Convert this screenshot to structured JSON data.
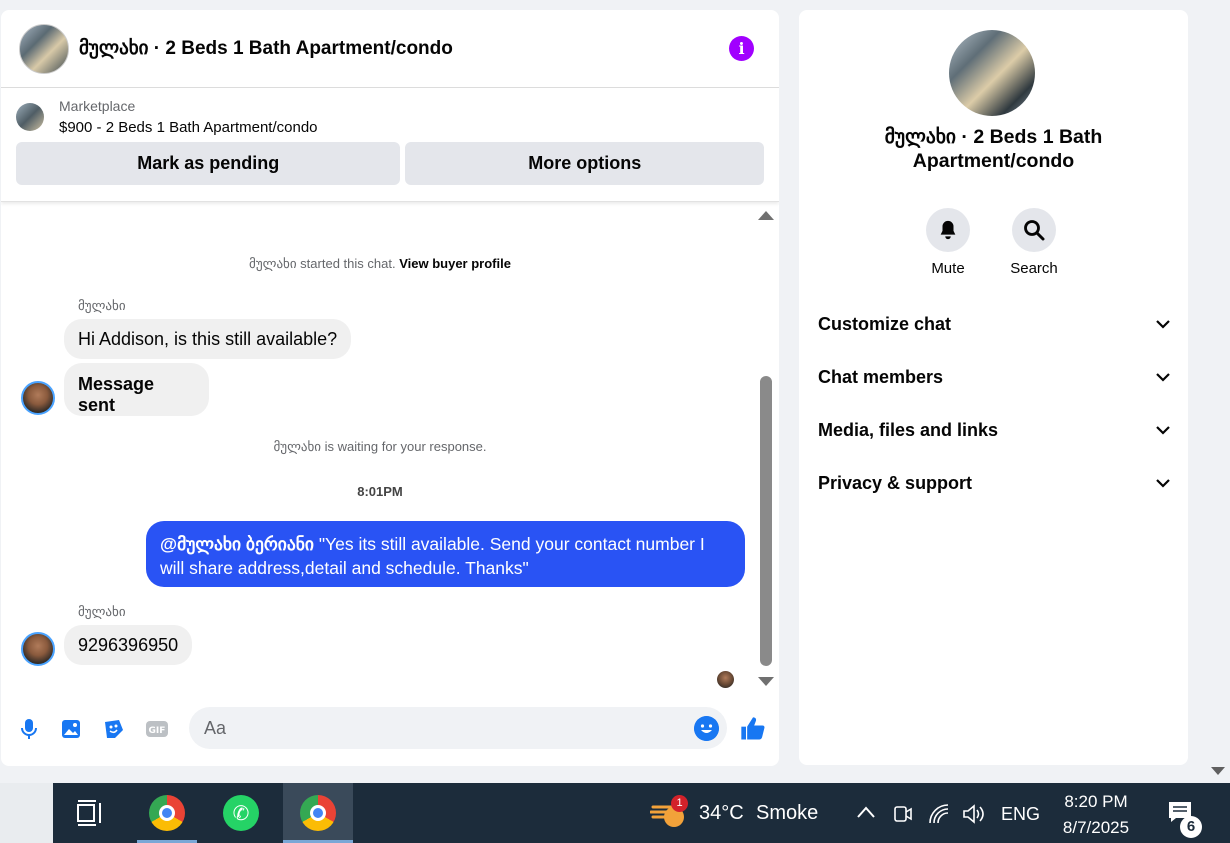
{
  "chat": {
    "title": "მულახი · 2 Beds 1 Bath Apartment/condo",
    "marketplace_label": "Marketplace",
    "listing": "$900 - 2 Beds 1 Bath Apartment/condo",
    "mark_pending_label": "Mark as pending",
    "more_options_label": "More options",
    "started_text": "მულახი started this chat.",
    "view_buyer_profile": "View buyer profile",
    "sender_name_1": "მულახი",
    "msg_1": "Hi Addison, is this still available?",
    "msg_2": "Message sent",
    "waiting_text": "მულახი is waiting for your response.",
    "time": "8:01PM",
    "out_mention": "@მულახი ბერიანი",
    "out_text": "\"Yes its still available. Send your contact number I will share address,detail and schedule. Thanks\"",
    "sender_name_2": "მულახი",
    "msg_3": "9296396950",
    "input_placeholder": "Aa"
  },
  "side": {
    "title": "მულახი · 2 Beds 1 Bath Apartment/condo",
    "mute_label": "Mute",
    "search_label": "Search",
    "menu": [
      {
        "label": "Customize chat"
      },
      {
        "label": "Chat members"
      },
      {
        "label": "Media, files and links"
      },
      {
        "label": "Privacy & support"
      }
    ]
  },
  "taskbar": {
    "weather_badge": "1",
    "temperature": "34°C",
    "weather_text": "Smoke",
    "language": "ENG",
    "time": "8:20 PM",
    "date": "8/7/2025",
    "notification_count": "6"
  },
  "colors": {
    "outgoing_bubble": "#2953f4",
    "accent_blue": "#1877f2",
    "info_purple": "#a100ff",
    "taskbar": "#1c2c3b"
  }
}
